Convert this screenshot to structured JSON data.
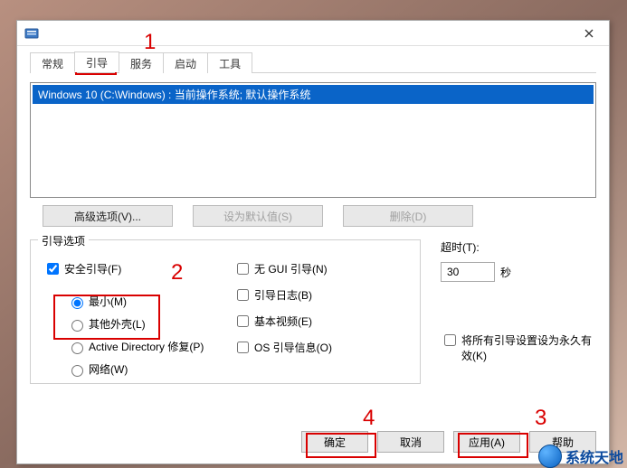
{
  "tabs": {
    "general": "常规",
    "boot": "引导",
    "services": "服务",
    "startup": "启动",
    "tools": "工具"
  },
  "list": {
    "item0": "Windows 10 (C:\\Windows) : 当前操作系统; 默认操作系统"
  },
  "buttons": {
    "advanced": "高级选项(V)...",
    "setdefault": "设为默认值(S)",
    "delete": "删除(D)",
    "ok": "确定",
    "cancel": "取消",
    "apply": "应用(A)",
    "help": "帮助"
  },
  "groupbox": {
    "title": "引导选项",
    "safeboot": "安全引导(F)",
    "minimal": "最小(M)",
    "altshell": "其他外壳(L)",
    "adrepair": "Active Directory 修复(P)",
    "network": "网络(W)",
    "nogui": "无 GUI 引导(N)",
    "bootlog": "引导日志(B)",
    "basevideo": "基本视频(E)",
    "osbootinfo": "OS 引导信息(O)"
  },
  "timeout": {
    "label": "超时(T):",
    "value": "30",
    "unit": "秒"
  },
  "permanent": "将所有引导设置设为永久有效(K)",
  "annotations": {
    "n1": "1",
    "n2": "2",
    "n3": "3",
    "n4": "4"
  },
  "watermark": "系统天地"
}
